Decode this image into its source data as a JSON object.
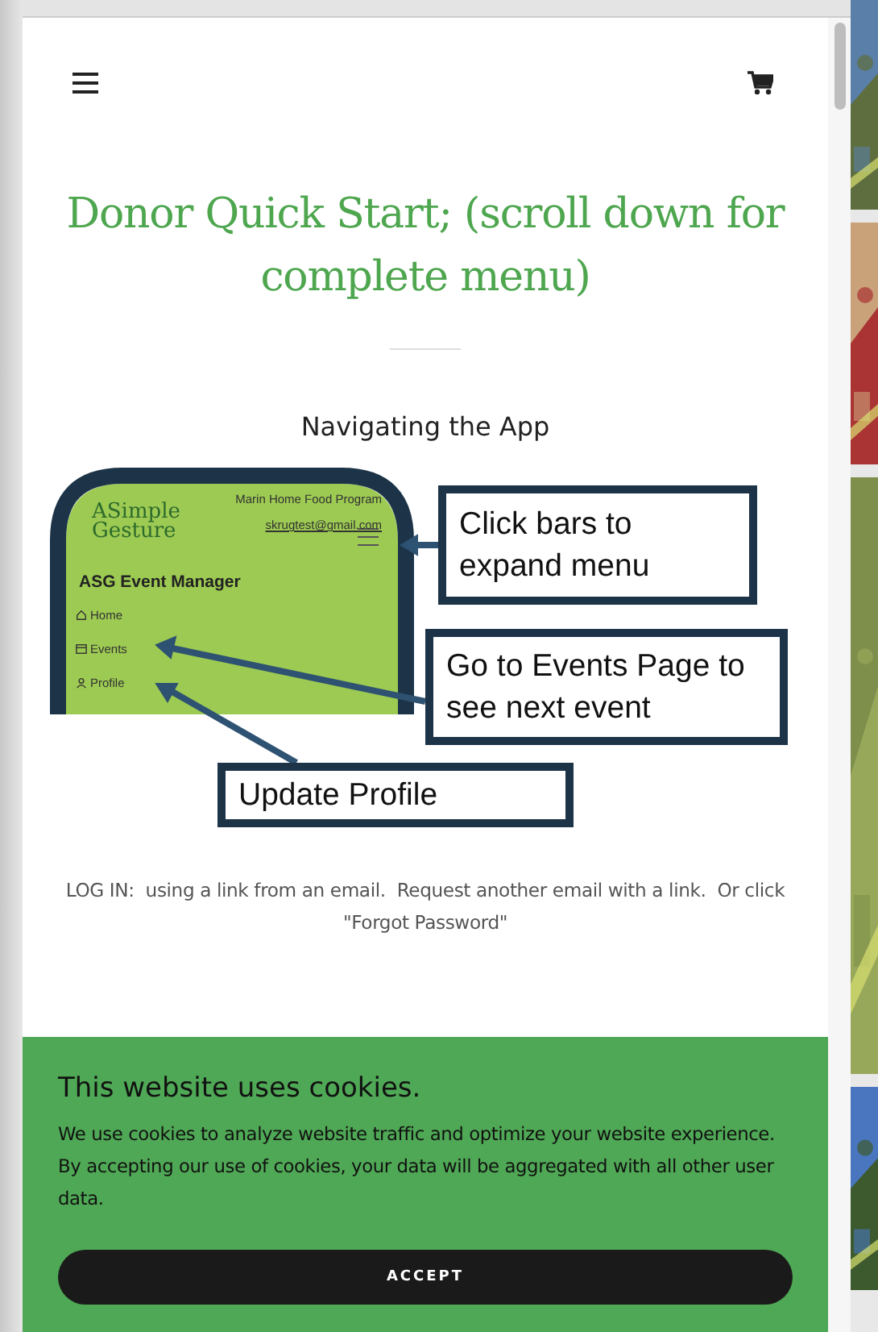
{
  "page": {
    "title": "Donor Quick Start; (scroll down for complete menu)",
    "section_heading": "Navigating the App",
    "guide_image": {
      "app_org": "Marin Home Food Program",
      "app_email": "skrugtest@gmail.com",
      "logo": "ASimple Gesture",
      "app_title": "ASG Event Manager",
      "menu_items": [
        "Home",
        "Events",
        "Profile"
      ],
      "callouts": [
        "Click bars to expand menu",
        "Go to Events Page to see next event",
        "Update Profile"
      ]
    },
    "login_note": "LOG IN:  using a link from an email.  Request another email with a link.  Or click \"Forgot Password\""
  },
  "cookie_banner": {
    "title": "This website uses cookies.",
    "message": "We use cookies to analyze website traffic and optimize your website experience. By accepting our use of cookies, your data will be aggregated with all other user data.",
    "button": "ACCEPT"
  }
}
